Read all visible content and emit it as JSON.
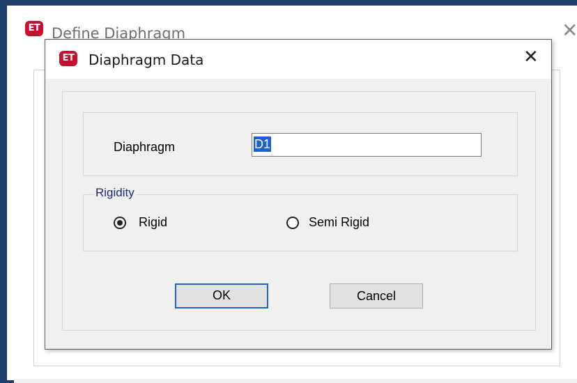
{
  "outer_window": {
    "logo_text": "ET",
    "title": "Define Diaphragm",
    "close_glyph": "✕"
  },
  "dialog": {
    "logo_text": "ET",
    "title": "Diaphragm Data",
    "close_glyph": "✕",
    "diaphragm_label": "Diaphragm",
    "diaphragm_value": "D1",
    "rigidity_legend": "Rigidity",
    "rigidity_options": [
      {
        "label": "Rigid",
        "selected": true
      },
      {
        "label": "Semi Rigid",
        "selected": false
      }
    ],
    "ok_label": "OK",
    "cancel_label": "Cancel"
  },
  "colors": {
    "window_frame": "#1e3d6b",
    "logo_red": "#c8102e",
    "selection_blue": "#1f5fd6",
    "default_button_border": "#1e64c8",
    "legend_text": "#1a2a7a"
  }
}
